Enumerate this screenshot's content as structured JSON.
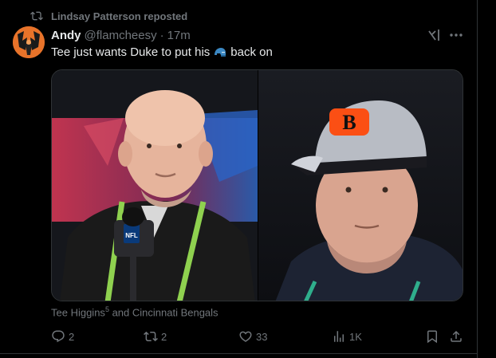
{
  "repost": {
    "text": "Lindsay Patterson reposted"
  },
  "author": {
    "name": "Andy",
    "handle": "@flamcheesy",
    "separator": "·",
    "time": "17m"
  },
  "tweet": {
    "text_before": "Tee just wants Duke to put his",
    "text_after": "back on"
  },
  "media": {
    "left_logo_text": "NFL",
    "right_logo_text": "B"
  },
  "caption": {
    "name": "Tee Higgins",
    "sup": "5",
    "rest": " and Cincinnati Bengals"
  },
  "actions": {
    "reply_count": "2",
    "repost_count": "2",
    "like_count": "33",
    "views_count": "1K"
  },
  "colors": {
    "background": "#000000",
    "text": "#e7e9ea",
    "muted": "#71767b",
    "border": "#2f3336",
    "bengals_orange": "#fb4f14"
  },
  "icons": [
    "repost-icon",
    "grok-icon",
    "more-icon",
    "helmet-emoji",
    "reply-icon",
    "retweet-icon",
    "like-icon",
    "views-icon",
    "bookmark-icon",
    "share-icon"
  ]
}
